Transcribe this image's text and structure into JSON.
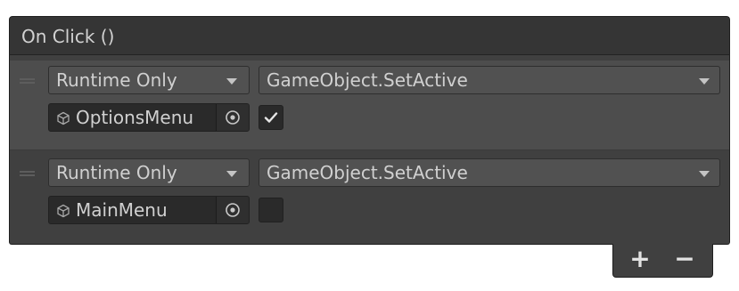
{
  "event": {
    "title": "On Click ()"
  },
  "entries": [
    {
      "mode": "Runtime Only",
      "target": "OptionsMenu",
      "function": "GameObject.SetActive",
      "checked": true
    },
    {
      "mode": "Runtime Only",
      "target": "MainMenu",
      "function": "GameObject.SetActive",
      "checked": false
    }
  ],
  "footer": {
    "add_label": "+",
    "remove_label": "−"
  },
  "icons": {
    "object": "gameobject-cube-icon",
    "picker": "object-picker-icon",
    "caret": "chevron-down-icon",
    "check": "checkmark-icon",
    "handle": "drag-handle-icon"
  }
}
